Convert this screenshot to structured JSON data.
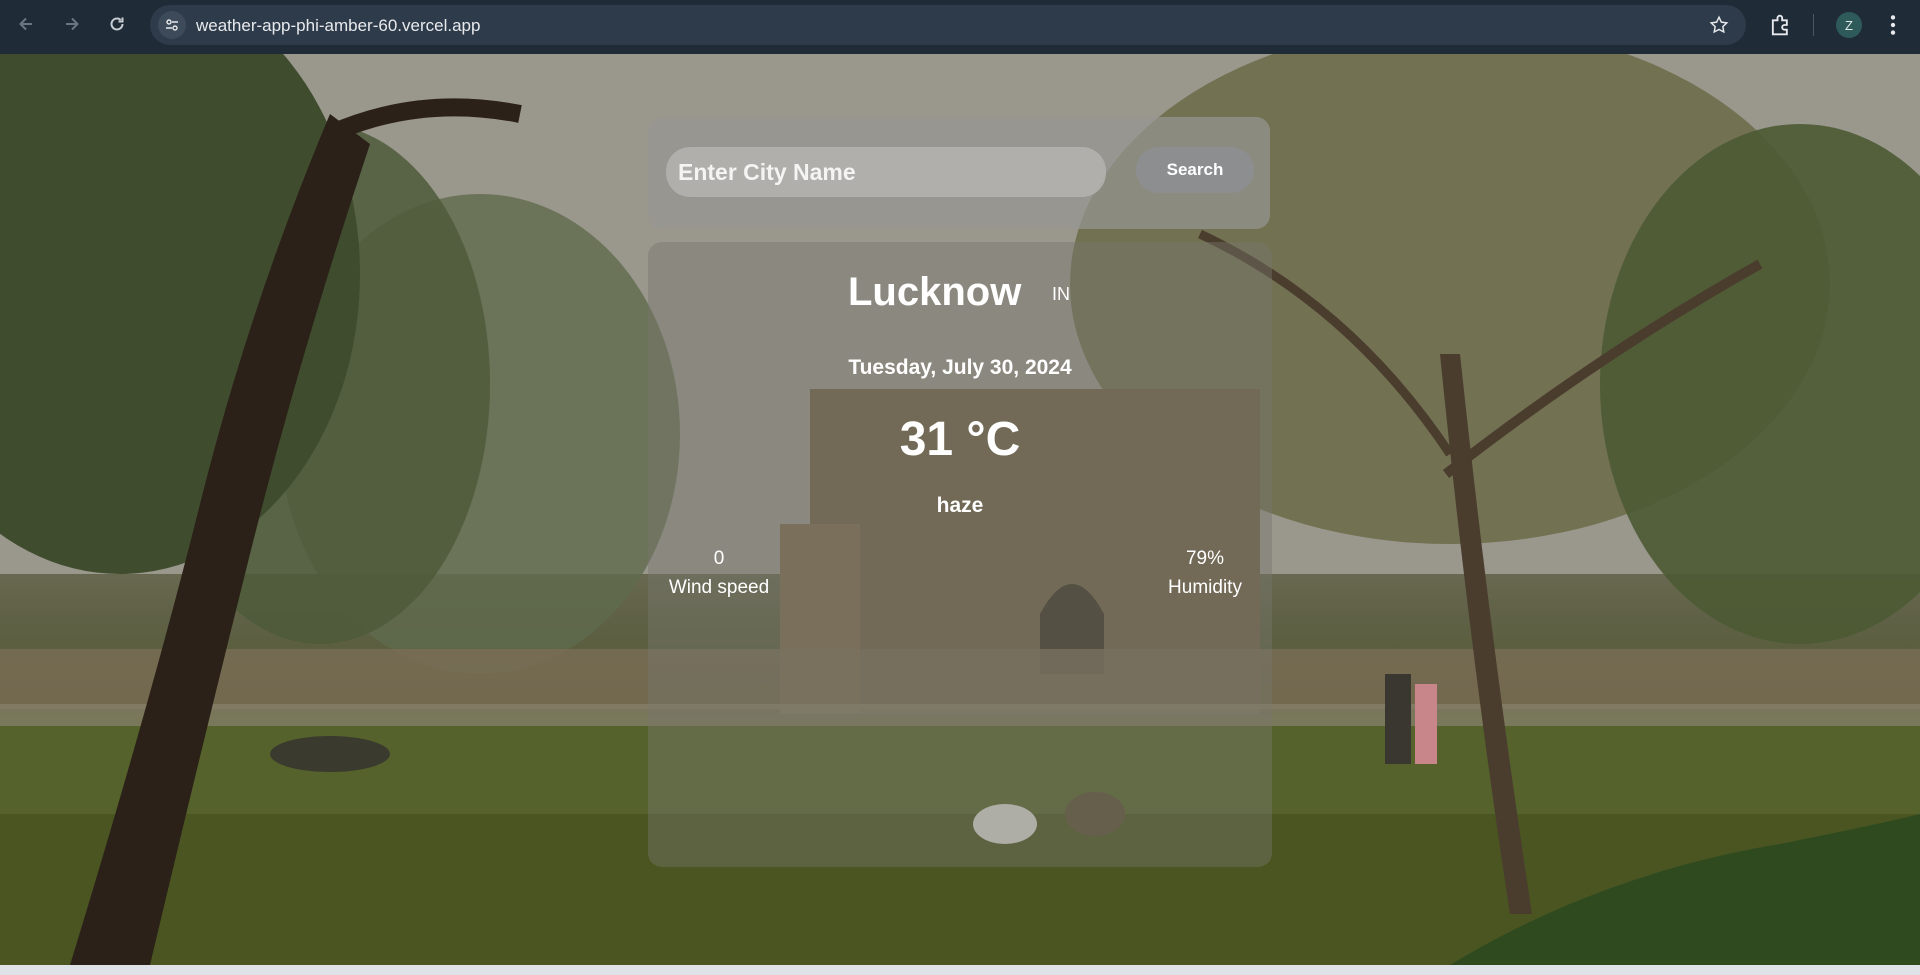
{
  "browser": {
    "url": "weather-app-phi-amber-60.vercel.app",
    "profile_initial": "Z"
  },
  "search": {
    "placeholder": "Enter City Name",
    "button_label": "Search"
  },
  "weather": {
    "city": "Lucknow",
    "country": "IN",
    "date": "Tuesday, July 30, 2024",
    "temperature": "31 °C",
    "condition": "haze",
    "wind_speed_value": "0",
    "wind_speed_label": "Wind speed",
    "humidity_value": "79%",
    "humidity_label": "Humidity"
  }
}
